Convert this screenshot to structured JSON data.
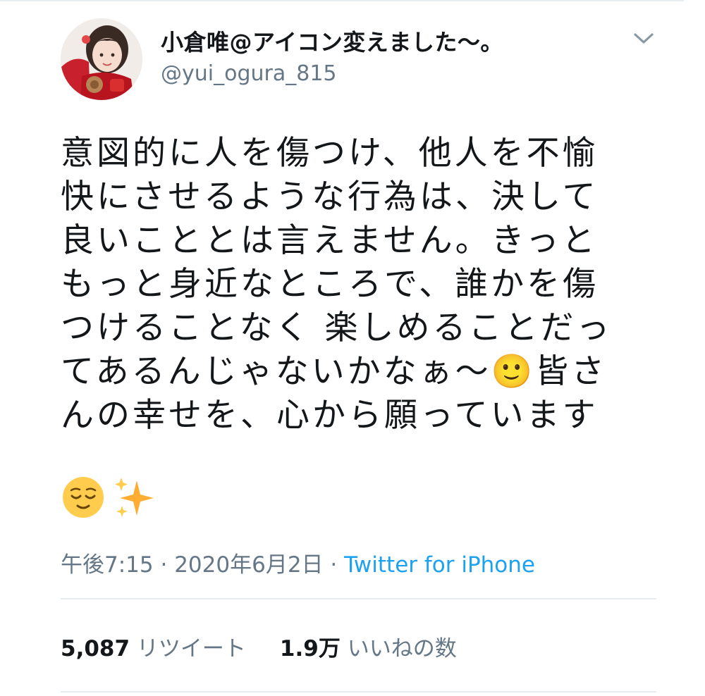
{
  "tweet": {
    "author": {
      "display_name": "小倉唯@アイコン変えました〜。",
      "handle": "@yui_ogura_815"
    },
    "body_text": "意図的に人を傷つけ、他人を不愉\n快にさせるような行為は、決して\n良いこととは言えません。きっと\nもっと身近なところで、誰かを傷\nつけることなく 楽しめることだっ\nてあるんじゃないかなぁ〜🙂皆さ\nんの幸せを、心から願っています",
    "trailing_emoji": [
      "relieved-face",
      "sparkles"
    ],
    "time": "午後7:15",
    "separator": "·",
    "date": "2020年6月2日",
    "source": "Twitter for iPhone",
    "stats": {
      "retweet_count": "5,087",
      "retweet_label": "リツイート",
      "like_count": "1.9万",
      "like_label": "いいねの数"
    }
  },
  "colors": {
    "text_primary": "#14171a",
    "text_secondary": "#657786",
    "link": "#1da1f2",
    "divider": "#e6ecf0"
  }
}
